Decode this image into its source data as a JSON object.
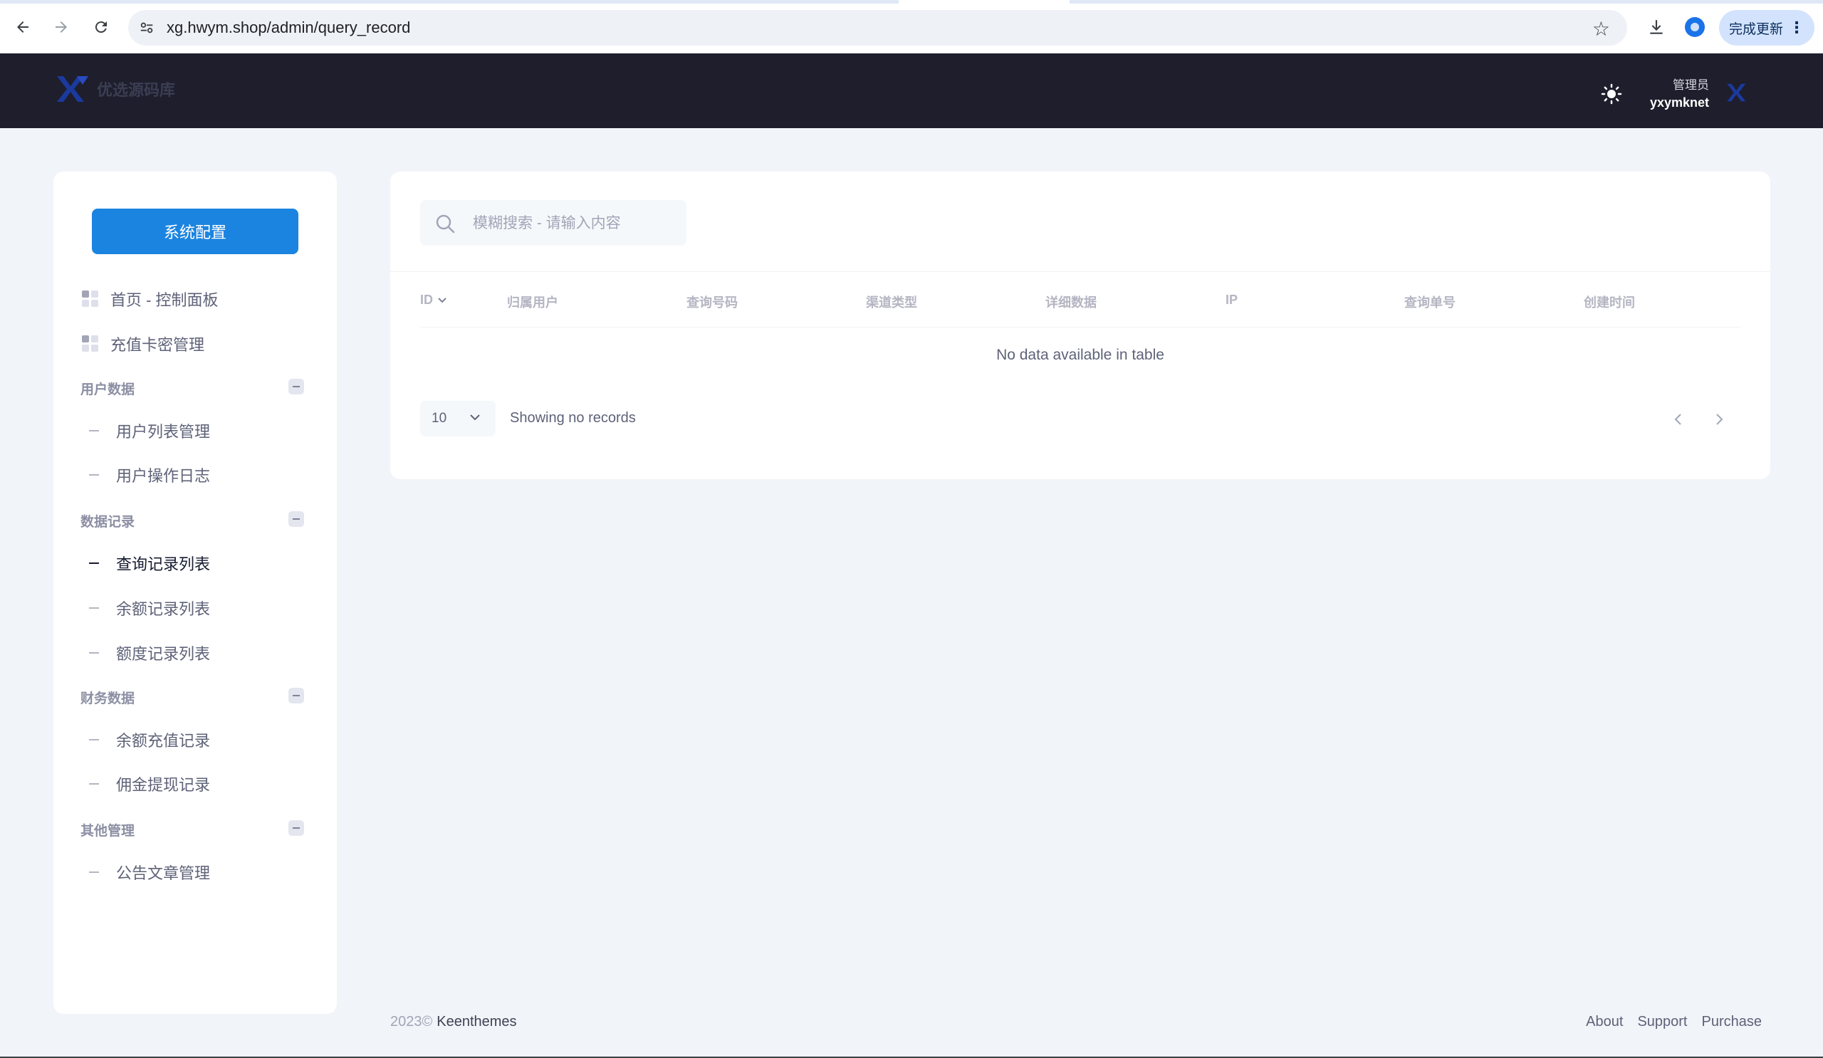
{
  "browser": {
    "url": "xg.hwym.shop/admin/query_record",
    "update_label": "完成更新"
  },
  "header": {
    "logo_text": "优选源码库",
    "user_role": "管理员",
    "user_name": "yxymknet"
  },
  "sidebar": {
    "config_button": "系统配置",
    "top_items": [
      {
        "label": "首页 - 控制面板"
      },
      {
        "label": "充值卡密管理"
      }
    ],
    "sections": [
      {
        "title": "用户数据",
        "items": [
          {
            "label": "用户列表管理"
          },
          {
            "label": "用户操作日志"
          }
        ]
      },
      {
        "title": "数据记录",
        "items": [
          {
            "label": "查询记录列表"
          },
          {
            "label": "余额记录列表"
          },
          {
            "label": "额度记录列表"
          }
        ]
      },
      {
        "title": "财务数据",
        "items": [
          {
            "label": "余额充值记录"
          },
          {
            "label": "佣金提现记录"
          }
        ]
      },
      {
        "title": "其他管理",
        "items": [
          {
            "label": "公告文章管理"
          }
        ]
      }
    ]
  },
  "main": {
    "search_placeholder": "模糊搜索 - 请输入内容",
    "columns": [
      "ID",
      "归属用户",
      "查询号码",
      "渠道类型",
      "详细数据",
      "IP",
      "查询单号",
      "创建时间"
    ],
    "empty_message": "No data available in table",
    "page_size": "10",
    "showing_text": "Showing no records"
  },
  "footer": {
    "year": "2023©",
    "brand": "Keenthemes",
    "links": [
      "About",
      "Support",
      "Purchase"
    ]
  },
  "colors": {
    "header_bg": "#1e1e2d",
    "primary": "#1b84e0",
    "page_bg": "#f1f4f8"
  }
}
